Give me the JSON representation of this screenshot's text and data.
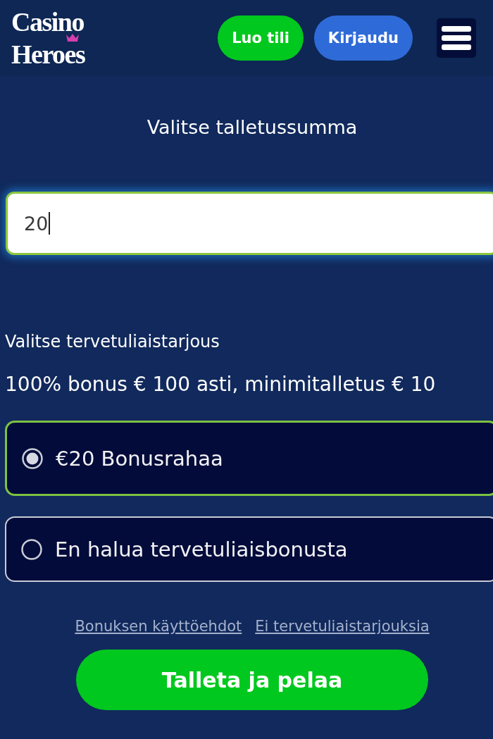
{
  "header": {
    "logo_lines": [
      "Casino",
      "Heroes"
    ],
    "buttons": [
      {
        "label": "Luo tili",
        "kind": "register"
      },
      {
        "label": "Kirjaudu",
        "kind": "login"
      }
    ]
  },
  "deposit": {
    "title": "Valitse talletussumma",
    "amount_field": {
      "value": "20",
      "focused": true
    }
  },
  "offer": {
    "title": "Valitse tervetuliaistarjous",
    "description": "100% bonus € 100 asti, minimitalletus € 10",
    "options": [
      {
        "label": "€20 Bonusrahaa",
        "selected": true
      },
      {
        "label": "En halua tervetuliaisbonusta",
        "selected": false
      }
    ]
  },
  "links": [
    "Bonuksen käyttöehdot",
    "Ei tervetuliaistarjouksia"
  ],
  "submit_button": "Talleta ja pelaa"
}
